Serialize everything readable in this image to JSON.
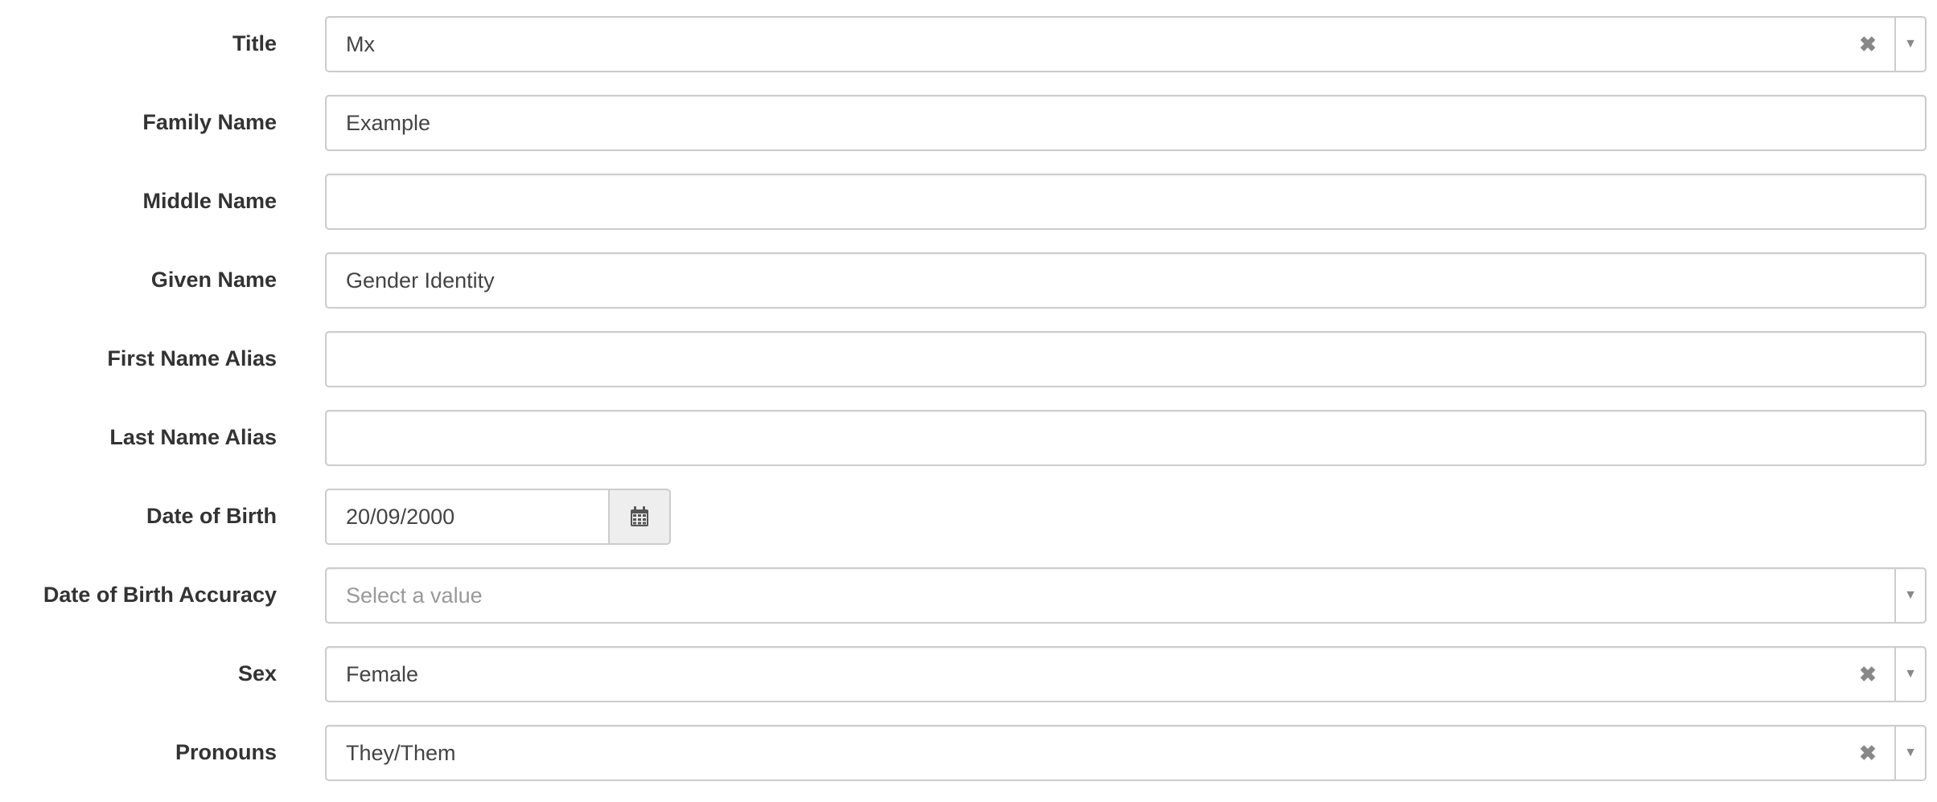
{
  "form": {
    "title": {
      "label": "Title",
      "value": "Mx",
      "clear_glyph": "✖",
      "arrow_glyph": "▼"
    },
    "family_name": {
      "label": "Family Name",
      "value": "Example"
    },
    "middle_name": {
      "label": "Middle Name",
      "value": ""
    },
    "given_name": {
      "label": "Given Name",
      "value": "Gender Identity"
    },
    "first_name_alias": {
      "label": "First Name Alias",
      "value": ""
    },
    "last_name_alias": {
      "label": "Last Name Alias",
      "value": ""
    },
    "date_of_birth": {
      "label": "Date of Birth",
      "value": "20/09/2000",
      "button_icon": "calendar-icon"
    },
    "date_of_birth_accuracy": {
      "label": "Date of Birth Accuracy",
      "placeholder": "Select a value",
      "arrow_glyph": "▼"
    },
    "sex": {
      "label": "Sex",
      "value": "Female",
      "clear_glyph": "✖",
      "arrow_glyph": "▼"
    },
    "pronouns": {
      "label": "Pronouns",
      "value": "They/Them",
      "clear_glyph": "✖",
      "arrow_glyph": "▼"
    }
  },
  "colors": {
    "border": "#cccccc",
    "label_text": "#333333",
    "value_text": "#444444",
    "placeholder_text": "#999999",
    "button_bg": "#eeeeee"
  }
}
